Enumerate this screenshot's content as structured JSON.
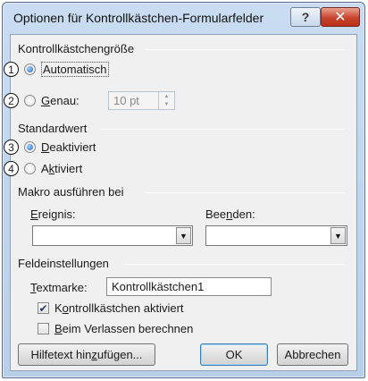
{
  "dialog": {
    "title": "Optionen für Kontrollkästchen-Formularfelder",
    "help_icon": "?",
    "close_icon": "✕"
  },
  "size_group": {
    "label": "Kontrollkästchengröße",
    "automatic": {
      "label": "Automatisch",
      "selected": true,
      "marker": "1"
    },
    "exact": {
      "label_pre": "",
      "accel": "G",
      "label_post": "enau:",
      "selected": false,
      "marker": "2"
    },
    "exact_value": "10 pt"
  },
  "default_group": {
    "label": "Standardwert",
    "off": {
      "accel": "D",
      "label_post": "eaktiviert",
      "selected": true,
      "marker": "3"
    },
    "on": {
      "label_pre": "A",
      "accel": "k",
      "label_post": "tiviert",
      "selected": false,
      "marker": "4"
    }
  },
  "macro_group": {
    "label": "Makro ausführen bei",
    "entry": {
      "accel": "E",
      "label_post": "reignis:",
      "value": ""
    },
    "exit": {
      "label_pre": "Bee",
      "accel": "n",
      "label_post": "den:",
      "value": ""
    }
  },
  "field_settings": {
    "label": "Feldeinstellungen",
    "bookmark": {
      "accel": "T",
      "label_post": "extmarke:",
      "value": "Kontrollkästchen1"
    },
    "enabled": {
      "label_pre": "K",
      "accel": "o",
      "label_post": "ntrollkästchen aktiviert",
      "checked": true
    },
    "calc_on_exit": {
      "accel": "B",
      "label_post": "eim Verlassen berechnen",
      "checked": false
    }
  },
  "buttons": {
    "help_text": {
      "label_pre": "Hilfetext hin",
      "accel": "z",
      "label_post": "ufügen..."
    },
    "ok": "OK",
    "cancel": "Abbrechen"
  },
  "icons": {
    "checkmark": "✔",
    "dropdown": "▼",
    "spin_up": "▲",
    "spin_down": "▼"
  }
}
